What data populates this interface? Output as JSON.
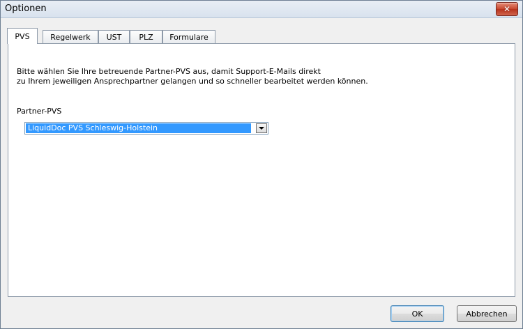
{
  "window": {
    "title": "Optionen"
  },
  "tabs": [
    {
      "label": "PVS",
      "active": true
    },
    {
      "label": "Regelwerk",
      "active": false
    },
    {
      "label": "UST",
      "active": false
    },
    {
      "label": "PLZ",
      "active": false
    },
    {
      "label": "Formulare",
      "active": false
    }
  ],
  "content": {
    "description_line1": "Bitte wählen Sie Ihre betreuende Partner-PVS aus, damit Support-E-Mails direkt",
    "description_line2": "zu Ihrem jeweiligen Ansprechpartner gelangen und so schneller bearbeitet werden können.",
    "partner_label": "Partner-PVS",
    "partner_selected": "LiquidDoc PVS Schleswig-Holstein"
  },
  "buttons": {
    "ok": "OK",
    "cancel": "Abbrechen"
  },
  "colors": {
    "selection": "#3399ff",
    "close_button": "#c94b32"
  }
}
